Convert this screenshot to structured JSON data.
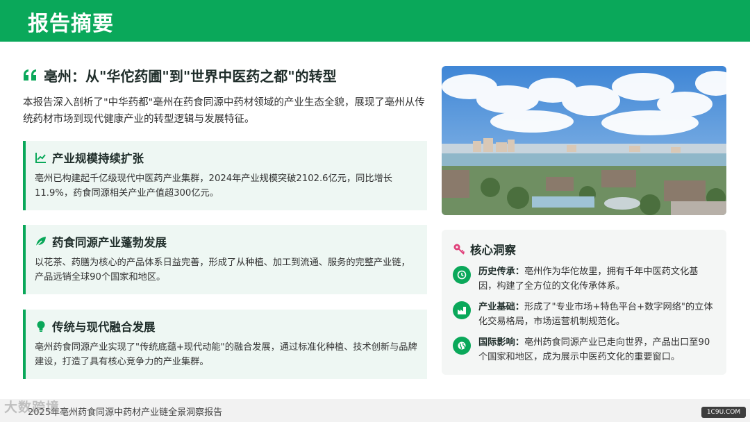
{
  "header": {
    "title": "报告摘要"
  },
  "main": {
    "headline": "亳州：从\"华佗药圃\"到\"世界中医药之都\"的转型",
    "intro": "本报告深入剖析了\"中华药都\"亳州在药食同源中药材领域的产业生态全貌，展现了亳州从传统药材市场到现代健康产业的转型逻辑与发展特征。"
  },
  "cards": [
    {
      "icon": "line-chart-icon",
      "title": "产业规模持续扩张",
      "text": "亳州已构建起千亿级现代中医药产业集群，2024年产业规模突破2102.6亿元，同比增长11.9%，药食同源相关产业产值超300亿元。"
    },
    {
      "icon": "leaf-icon",
      "title": "药食同源产业蓬勃发展",
      "text": "以花茶、药膳为核心的产品体系日益完善，形成了从种植、加工到流通、服务的完整产业链，产品远销全球90个国家和地区。"
    },
    {
      "icon": "lightbulb-icon",
      "title": "传统与现代融合发展",
      "text": "亳州药食同源产业实现了\"传统底蕴+现代动能\"的融合发展，通过标准化种植、技术创新与品牌建设，打造了具有核心竞争力的产业集群。"
    }
  ],
  "insights": {
    "icon": "key-icon",
    "title": "核心洞察",
    "items": [
      {
        "icon": "history-icon",
        "label": "历史传承：",
        "text": "亳州作为华佗故里，拥有千年中医药文化基因，构建了全方位的文化传承体系。"
      },
      {
        "icon": "industry-icon",
        "label": "产业基础：",
        "text": "形成了\"专业市场+特色平台+数字网络\"的立体化交易格局，市场运营机制规范化。"
      },
      {
        "icon": "globe-icon",
        "label": "国际影响：",
        "text": "亳州药食同源产业已走向世界，产品出口至90个国家和地区，成为展示中医药文化的重要窗口。"
      }
    ]
  },
  "footer": {
    "text": "2025年亳州药食同源中药材产业链全景洞察报告",
    "watermark": "大数跨境",
    "site": "1C9U.COM"
  },
  "colors": {
    "accent": "#0aa85a",
    "card_bg": "#eef7f3",
    "icon_pink": "#e0407a"
  }
}
